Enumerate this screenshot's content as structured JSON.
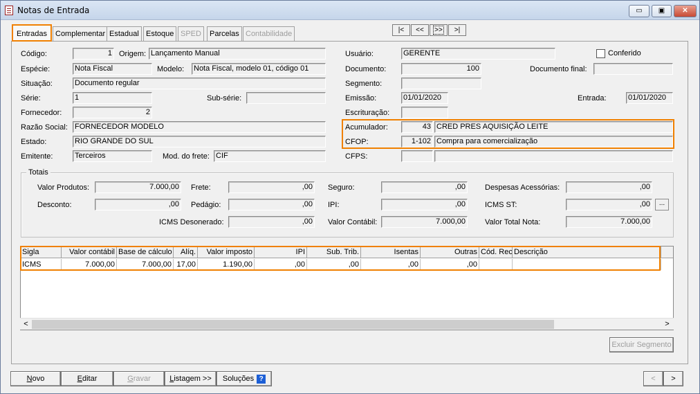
{
  "window": {
    "title": "Notas de Entrada",
    "minimize": "▭",
    "maximize": "▣",
    "close": "✕"
  },
  "tabs": [
    {
      "label": "Entradas",
      "active": true
    },
    {
      "label": "Complementar"
    },
    {
      "label": "Estadual"
    },
    {
      "label": "Estoque"
    },
    {
      "label": "SPED",
      "disabled": true
    },
    {
      "label": "Parcelas"
    },
    {
      "label": "Contabilidade",
      "disabled": true
    }
  ],
  "nav": {
    "first": "|<",
    "prev": "<<",
    "next": ">>",
    "last": ">|"
  },
  "form": {
    "codigo": {
      "label": "Código:",
      "value": "1"
    },
    "origem": {
      "label": "Origem:",
      "value": "Lançamento Manual"
    },
    "usuario": {
      "label": "Usuário:",
      "value": "GERENTE"
    },
    "conferido": {
      "label": "Conferido",
      "checked": false
    },
    "especie": {
      "label": "Espécie:",
      "value": "Nota Fiscal"
    },
    "modelo": {
      "label": "Modelo:",
      "value": "Nota Fiscal, modelo 01, código 01"
    },
    "documento": {
      "label": "Documento:",
      "value": "100"
    },
    "documento_final": {
      "label": "Documento final:",
      "value": ""
    },
    "situacao": {
      "label": "Situação:",
      "value": "Documento regular"
    },
    "segmento": {
      "label": "Segmento:",
      "value": ""
    },
    "serie": {
      "label": "Série:",
      "value": "1"
    },
    "subserie": {
      "label": "Sub-série:",
      "value": ""
    },
    "emissao": {
      "label": "Emissão:",
      "value": "01/01/2020"
    },
    "entrada": {
      "label": "Entrada:",
      "value": "01/01/2020"
    },
    "fornecedor": {
      "label": "Fornecedor:",
      "value": "2"
    },
    "escrituracao": {
      "label": "Escrituração:",
      "value": ""
    },
    "razao_social": {
      "label": "Razão Social:",
      "value": "FORNECEDOR MODELO"
    },
    "acumulador": {
      "label": "Acumulador:",
      "code": "43",
      "value": "CRED PRES AQUISIÇÃO LEITE"
    },
    "estado": {
      "label": "Estado:",
      "value": "RIO GRANDE DO SUL"
    },
    "cfop": {
      "label": "CFOP:",
      "code": "1-102",
      "value": "Compra para comercialização"
    },
    "emitente": {
      "label": "Emitente:",
      "value": "Terceiros"
    },
    "mod_frete": {
      "label": "Mod. do frete:",
      "value": "CIF"
    },
    "cfps": {
      "label": "CFPS:",
      "code": "",
      "value": ""
    }
  },
  "totais": {
    "title": "Totais",
    "valor_produtos": {
      "label": "Valor Produtos:",
      "value": "7.000,00"
    },
    "frete": {
      "label": "Frete:",
      "value": ",00"
    },
    "seguro": {
      "label": "Seguro:",
      "value": ",00"
    },
    "despesas": {
      "label": "Despesas Acessórias:",
      "value": ",00"
    },
    "desconto": {
      "label": "Desconto:",
      "value": ",00"
    },
    "pedagio": {
      "label": "Pedágio:",
      "value": ",00"
    },
    "ipi": {
      "label": "IPI:",
      "value": ",00"
    },
    "icms_st": {
      "label": "ICMS ST:",
      "value": ",00"
    },
    "icms_st_btn": "...",
    "icms_desonerado": {
      "label": "ICMS Desonerado:",
      "value": ",00"
    },
    "valor_contabil": {
      "label": "Valor Contábil:",
      "value": "7.000,00"
    },
    "valor_total": {
      "label": "Valor Total Nota:",
      "value": "7.000,00"
    }
  },
  "grid": {
    "columns": [
      "Sigla",
      "Valor contábil",
      "Base de cálculo",
      "Alíq.",
      "Valor imposto",
      "IPI",
      "Sub. Trib.",
      "Isentas",
      "Outras",
      "Cód. Rec.",
      "Descrição"
    ],
    "rows": [
      [
        "ICMS",
        "7.000,00",
        "7.000,00",
        "17,00",
        "1.190,00",
        ",00",
        ",00",
        ",00",
        ",00",
        "",
        ""
      ]
    ],
    "scroll_left": "<",
    "scroll_right": ">"
  },
  "excluir_segmento": "Excluir Segmento",
  "buttons": {
    "novo_u": "N",
    "novo": "ovo",
    "editar_u": "E",
    "editar": "ditar",
    "gravar_u": "G",
    "gravar": "ravar",
    "listagem_u": "L",
    "listagem": "istagem >>",
    "solucoes": "Soluções",
    "help": "?",
    "prev": "<",
    "next": ">"
  }
}
